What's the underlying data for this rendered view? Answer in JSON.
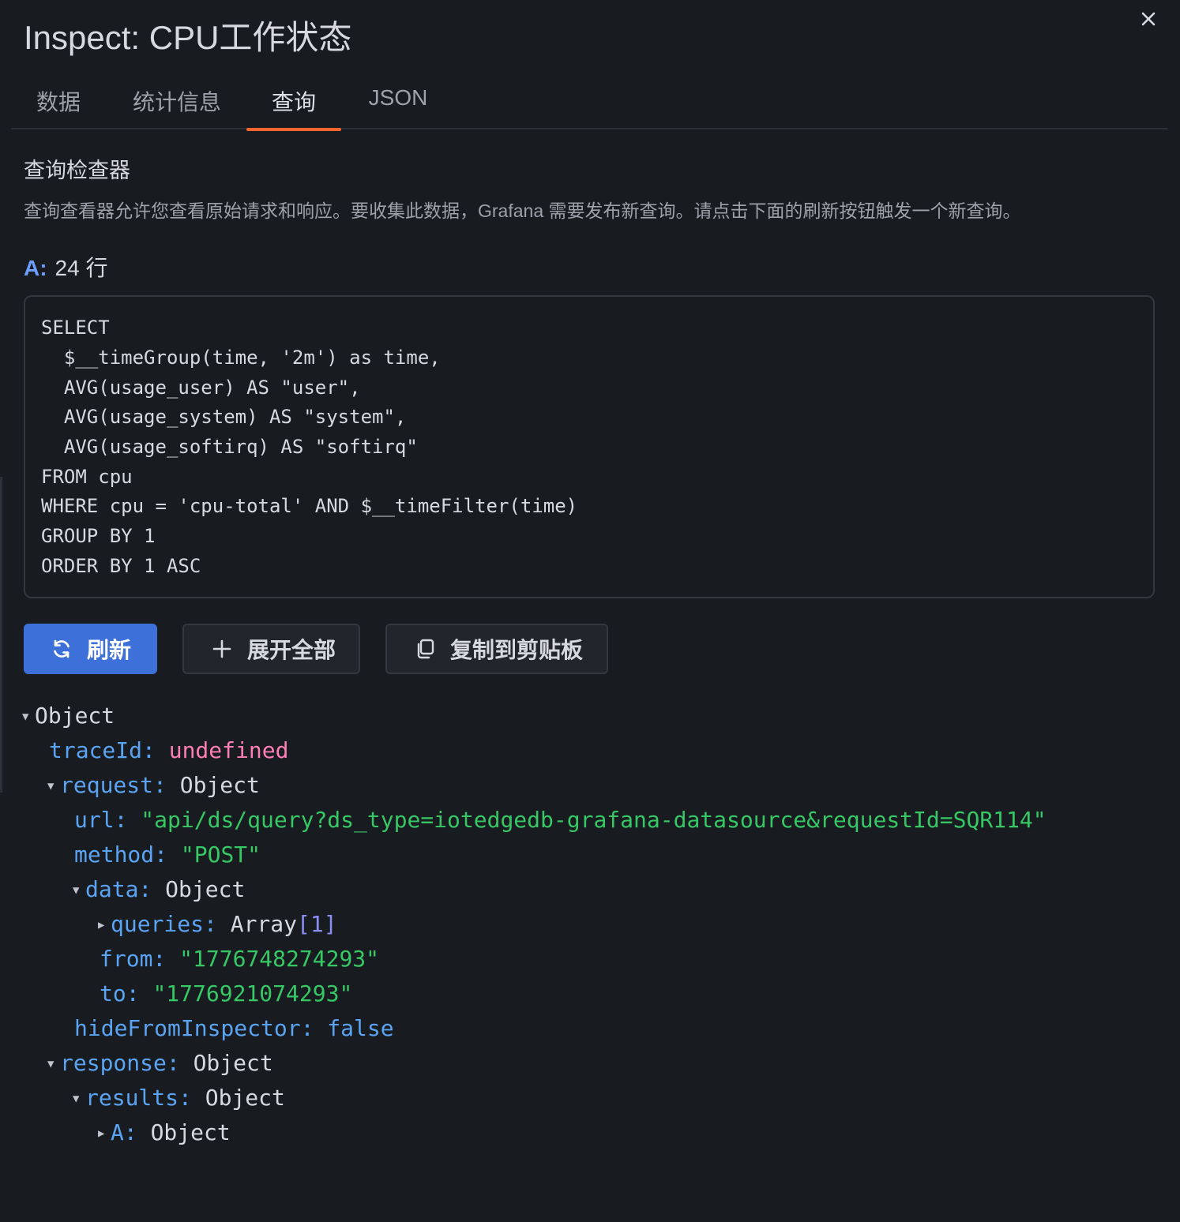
{
  "drawer": {
    "title": "Inspect: CPU工作状态",
    "close_icon": "close-icon"
  },
  "tabs": [
    {
      "label": "数据",
      "active": false
    },
    {
      "label": "统计信息",
      "active": false
    },
    {
      "label": "查询",
      "active": true
    },
    {
      "label": "JSON",
      "active": false
    }
  ],
  "inspector": {
    "title": "查询检查器",
    "description": "查询查看器允许您查看原始请求和响应。要收集此数据，Grafana 需要发布新查询。请点击下面的刷新按钮触发一个新查询。"
  },
  "query": {
    "ref_id": "A:",
    "rows": "24 行",
    "sql_lines": [
      "SELECT",
      "  $__timeGroup(time, '2m') as time,",
      "  AVG(usage_user) AS \"user\",",
      "  AVG(usage_system) AS \"system\",",
      "  AVG(usage_softirq) AS \"softirq\"",
      "FROM cpu",
      "WHERE cpu = 'cpu-total' AND $__timeFilter(time)",
      "GROUP BY 1",
      "ORDER BY 1 ASC"
    ]
  },
  "buttons": {
    "refresh": {
      "label": "刷新",
      "icon": "sync-icon"
    },
    "expand_all": {
      "label": "展开全部",
      "icon": "plus-icon"
    },
    "copy": {
      "label": "复制到剪贴板",
      "icon": "copy-icon"
    }
  },
  "tree": {
    "root": "Object",
    "trace_id": {
      "key": "traceId:",
      "value": "undefined"
    },
    "request": {
      "key": "request:",
      "value": "Object",
      "url": {
        "key": "url:",
        "value": "\"api/ds/query?ds_type=iotedgedb-grafana-datasource&requestId=SQR114\""
      },
      "method": {
        "key": "method:",
        "value": "\"POST\""
      },
      "data": {
        "key": "data:",
        "value": "Object",
        "queries": {
          "key": "queries:",
          "value": "Array",
          "count": "[1]"
        },
        "from": {
          "key": "from:",
          "value": "\"1776748274293\""
        },
        "to": {
          "key": "to:",
          "value": "\"1776921074293\""
        }
      },
      "hide_from_inspector": {
        "key": "hideFromInspector:",
        "value": "false"
      }
    },
    "response": {
      "key": "response:",
      "value": "Object",
      "results": {
        "key": "results:",
        "value": "Object"
      },
      "a": {
        "key": "A:",
        "value": "Object"
      }
    }
  },
  "colors": {
    "background": "#181b1f",
    "primary": "#3d71d9",
    "tab_underline": "#f0662e",
    "key": "#5ba4f3",
    "string": "#37c866",
    "undefined": "#ff7eb6",
    "array_count": "#8a8ff5"
  }
}
